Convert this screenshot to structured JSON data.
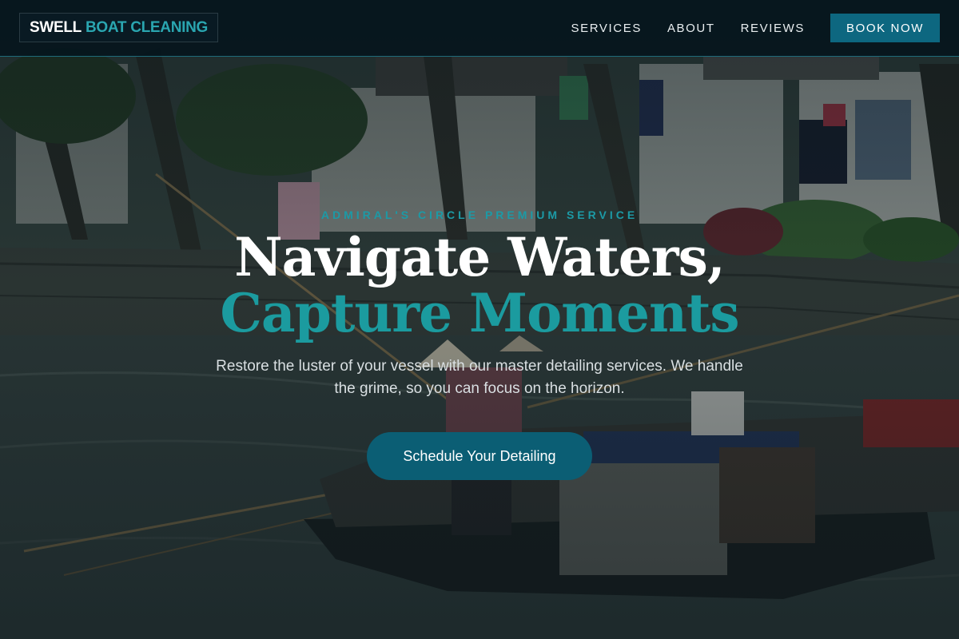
{
  "brand": {
    "name_part1": "SWELL",
    "name_part2": "BOAT CLEANING"
  },
  "nav": {
    "items": [
      {
        "label": "SERVICES"
      },
      {
        "label": "ABOUT"
      },
      {
        "label": "REVIEWS"
      }
    ],
    "cta_label": "BOOK NOW"
  },
  "hero": {
    "eyebrow": "ADMIRAL'S CIRCLE PREMIUM SERVICE",
    "title_line1": "Navigate Waters,",
    "title_line2": "Capture Moments",
    "subtitle": "Restore the luster of your vessel with our master detailing services. We handle the grime, so you can focus on the horizon.",
    "cta_label": "Schedule Your Detailing"
  },
  "colors": {
    "accent": "#1b9b9f",
    "button": "#0d6780",
    "header_bg": "#05141c"
  }
}
